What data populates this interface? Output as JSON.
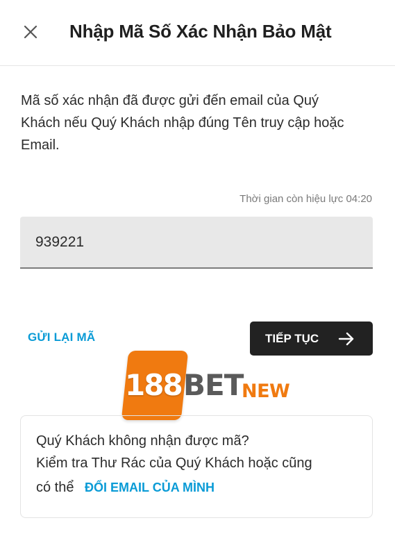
{
  "header": {
    "title": "Nhập Mã Số Xác Nhận Bảo Mật",
    "close_icon": "close-icon"
  },
  "description": "Mã số xác nhận đã được gửi đến email của Quý Khách nếu Quý Khách nhập đúng Tên truy cập hoặc Email.",
  "timer": {
    "text": "Thời gian còn hiệu lực 04:20"
  },
  "code_input": {
    "value": "939221"
  },
  "actions": {
    "resend_label": "GỬI LẠI MÃ",
    "continue_label": "TIẾP TỤC",
    "continue_icon": "arrow-right-icon"
  },
  "logo": {
    "number": "188",
    "brand": "BET",
    "suffix": "NEW"
  },
  "help": {
    "line1": "Quý Khách không nhận được mã?",
    "line2": "Kiểm tra Thư Rác của Quý Khách hoặc cũng",
    "line3": "có thể",
    "change_email_label": "ĐỔI EMAIL CỦA MÌNH"
  },
  "colors": {
    "accent": "#0a9bd6",
    "button_bg": "#222222",
    "input_bg": "#e8e8e8",
    "logo_orange": "#f07a10",
    "logo_gray": "#5a5a5a"
  }
}
